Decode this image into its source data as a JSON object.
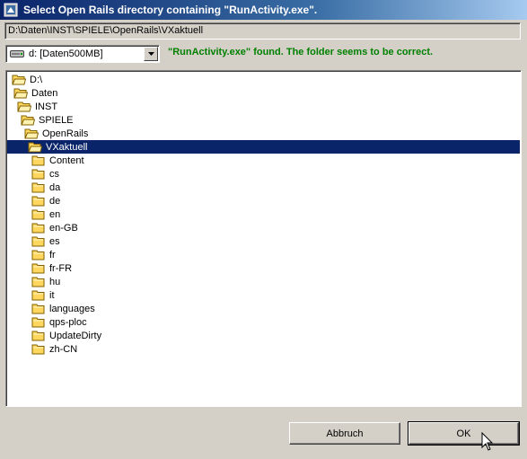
{
  "window": {
    "title": "Select Open Rails directory containing \"RunActivity.exe\"."
  },
  "path": {
    "value": "D:\\Daten\\INST\\SPIELE\\OpenRails\\VXaktuell"
  },
  "drive": {
    "selected": "d: [Daten500MB]"
  },
  "status": {
    "message": "\"RunActivity.exe\" found. The folder seems to be correct.",
    "color": "#008000"
  },
  "tree": {
    "nodes": [
      {
        "label": "D:\\"
      },
      {
        "label": "Daten"
      },
      {
        "label": "INST"
      },
      {
        "label": "SPIELE"
      },
      {
        "label": "OpenRails"
      },
      {
        "label": "VXaktuell",
        "selected": true
      },
      {
        "label": "Content"
      },
      {
        "label": "cs"
      },
      {
        "label": "da"
      },
      {
        "label": "de"
      },
      {
        "label": "en"
      },
      {
        "label": "en-GB"
      },
      {
        "label": "es"
      },
      {
        "label": "fr"
      },
      {
        "label": "fr-FR"
      },
      {
        "label": "hu"
      },
      {
        "label": "it"
      },
      {
        "label": "languages"
      },
      {
        "label": "qps-ploc"
      },
      {
        "label": "UpdateDirty"
      },
      {
        "label": "zh-CN"
      }
    ]
  },
  "buttons": {
    "cancel": "Abbruch",
    "ok": "OK"
  },
  "colors": {
    "selection": "#0a246a",
    "folder": "#ffd75e"
  }
}
